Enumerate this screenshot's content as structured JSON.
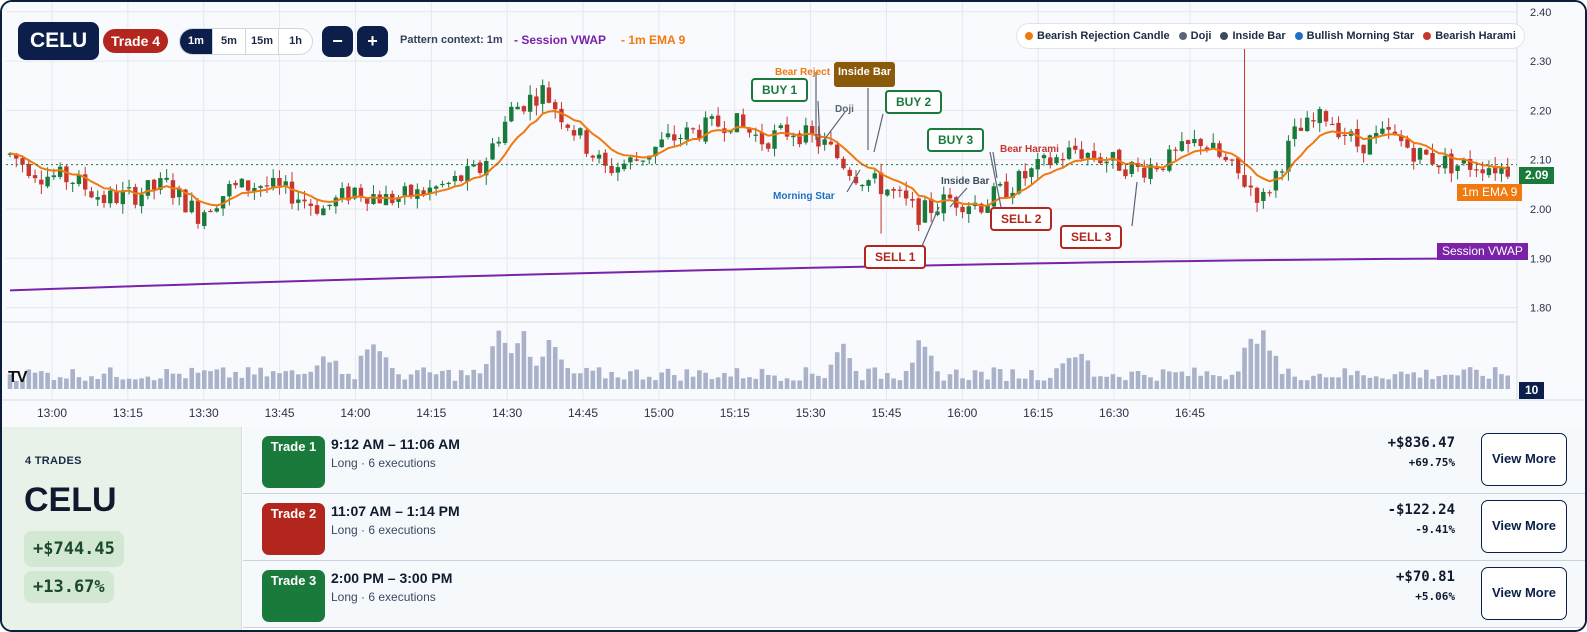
{
  "toolbar": {
    "ticker": "CELU",
    "trade_label": "Trade 4",
    "timeframes": [
      "1m",
      "5m",
      "15m",
      "1h"
    ],
    "active_timeframe": "1m",
    "zoom_out": "−",
    "zoom_in": "+",
    "pattern_context": "Pattern context: 1m",
    "vwap_legend": "- Session VWAP",
    "ema_legend": "- 1m EMA 9"
  },
  "pattern_legend": [
    {
      "label": "Bearish Rejection Candle",
      "color": "#f07a10"
    },
    {
      "label": "Doji",
      "color": "#5a6676"
    },
    {
      "label": "Inside Bar",
      "color": "#3c4c5c"
    },
    {
      "label": "Bullish Morning Star",
      "color": "#1f6fc4"
    },
    {
      "label": "Bearish Harami",
      "color": "#c8352c"
    }
  ],
  "colors": {
    "up": "#1a7a3c",
    "down": "#c8352c",
    "ema": "#f07a10",
    "vwap": "#7a22a8",
    "volume": "#a9b2c8",
    "navy": "#0b1f4a"
  },
  "signals": {
    "buy1": "BUY 1",
    "buy2": "BUY 2",
    "buy3": "BUY 3",
    "sell1": "SELL 1",
    "sell2": "SELL 2",
    "sell3": "SELL 3"
  },
  "pattern_labels": {
    "bear_reject": "Bear Reject",
    "inside_bar_top": "Inside Bar",
    "doji": "Doji",
    "morning_star": "Morning Star",
    "bear_harami": "Bear Harami",
    "inside_bar_mid": "Inside Bar"
  },
  "price_tags": {
    "last": "2.09",
    "ema": "1m EMA 9",
    "vwap": "Session VWAP",
    "volume": "10"
  },
  "chart_data": {
    "type": "candlestick",
    "x_ticks": [
      "13:00",
      "13:15",
      "13:30",
      "13:45",
      "14:00",
      "14:15",
      "14:30",
      "14:45",
      "15:00",
      "15:15",
      "15:30",
      "15:45",
      "16:00",
      "16:15",
      "16:30",
      "16:45"
    ],
    "y_ticks": [
      "2.40",
      "2.30",
      "2.20",
      "2.10",
      "2.00",
      "1.90",
      "1.80"
    ],
    "ylim": [
      1.75,
      2.44
    ],
    "last_price": 2.09,
    "vwap_start": 1.835,
    "vwap_end": 1.9,
    "close_path": [
      [
        0,
        2.11
      ],
      [
        5,
        2.07
      ],
      [
        10,
        2.06
      ],
      [
        15,
        2.02
      ],
      [
        20,
        2.03
      ],
      [
        25,
        2.05
      ],
      [
        30,
        1.99
      ],
      [
        35,
        2.04
      ],
      [
        40,
        2.05
      ],
      [
        45,
        2.03
      ],
      [
        50,
        2.0
      ],
      [
        55,
        2.04
      ],
      [
        60,
        2.02
      ],
      [
        65,
        2.03
      ],
      [
        70,
        2.05
      ],
      [
        75,
        2.08
      ],
      [
        80,
        2.2
      ],
      [
        85,
        2.24
      ],
      [
        90,
        2.16
      ],
      [
        95,
        2.08
      ],
      [
        100,
        2.1
      ],
      [
        105,
        2.14
      ],
      [
        110,
        2.16
      ],
      [
        115,
        2.18
      ],
      [
        120,
        2.14
      ],
      [
        125,
        2.16
      ],
      [
        130,
        2.13
      ],
      [
        135,
        2.07
      ],
      [
        140,
        2.04
      ],
      [
        145,
        1.99
      ],
      [
        150,
        2.02
      ],
      [
        155,
        2.01
      ],
      [
        160,
        2.05
      ],
      [
        165,
        2.09
      ],
      [
        170,
        2.12
      ],
      [
        175,
        2.1
      ],
      [
        180,
        2.08
      ],
      [
        185,
        2.1
      ],
      [
        190,
        2.14
      ],
      [
        195,
        2.08
      ],
      [
        200,
        2.02
      ],
      [
        205,
        2.15
      ],
      [
        210,
        2.19
      ],
      [
        215,
        2.13
      ],
      [
        220,
        2.15
      ],
      [
        225,
        2.11
      ],
      [
        230,
        2.09
      ],
      [
        235,
        2.09
      ],
      [
        240,
        2.08
      ]
    ],
    "volume_peaks": [
      [
        50,
        30
      ],
      [
        58,
        35
      ],
      [
        78,
        40
      ],
      [
        82,
        42
      ],
      [
        86,
        36
      ],
      [
        133,
        32
      ],
      [
        145,
        30
      ],
      [
        170,
        28
      ],
      [
        198,
        34
      ],
      [
        200,
        40
      ]
    ]
  },
  "summary": {
    "count": "4 TRADES",
    "ticker": "CELU",
    "pnl": "+$744.45",
    "pct": "+13.67%"
  },
  "trades": [
    {
      "label": "Trade 1",
      "color": "#1a7a3c",
      "time": "9:12 AM – 11:06 AM",
      "sub": "Long · 6 executions",
      "pnl": "+$836.47",
      "pct": "+69.75%",
      "button": "View More"
    },
    {
      "label": "Trade 2",
      "color": "#b3261e",
      "time": "11:07 AM – 1:14 PM",
      "sub": "Long · 6 executions",
      "pnl": "-$122.24",
      "pct": "-9.41%",
      "button": "View More"
    },
    {
      "label": "Trade 3",
      "color": "#1a7a3c",
      "time": "2:00 PM – 3:00 PM",
      "sub": "Long · 6 executions",
      "pnl": "+$70.81",
      "pct": "+5.06%",
      "button": "View More"
    }
  ]
}
